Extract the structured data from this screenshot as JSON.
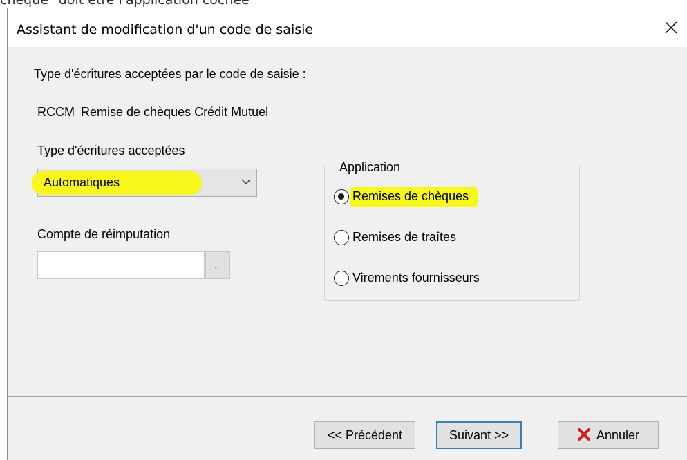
{
  "page_fragment": "chèque\" doit être l'application cochée",
  "window": {
    "title": "Assistant de modification d'un code de saisie"
  },
  "intro_label": "Type d'écritures acceptées par le code de saisie :",
  "code": {
    "id": "RCCM",
    "description": "Remise de chèques Crédit Mutuel"
  },
  "entry_type": {
    "label": "Type d'écritures acceptées",
    "selected": "Automatiques"
  },
  "account": {
    "label": "Compte de réimputation",
    "value": "",
    "browse_label": "..."
  },
  "application": {
    "legend": "Application",
    "options": [
      {
        "label": "Remises de chèques",
        "selected": true
      },
      {
        "label": "Remises de traîtes",
        "selected": false
      },
      {
        "label": "Virements fournisseurs",
        "selected": false
      }
    ]
  },
  "buttons": {
    "previous": "<< Précédent",
    "next": "Suivant >>",
    "cancel": "Annuler"
  },
  "colors": {
    "highlight": "#f7f71c",
    "cancel_icon": "#cc1f1f",
    "default_border": "#3c7fb1"
  },
  "icons": {
    "close": "close-icon",
    "dropdown": "chevron-down-icon",
    "cancel": "cancel-x-icon"
  }
}
